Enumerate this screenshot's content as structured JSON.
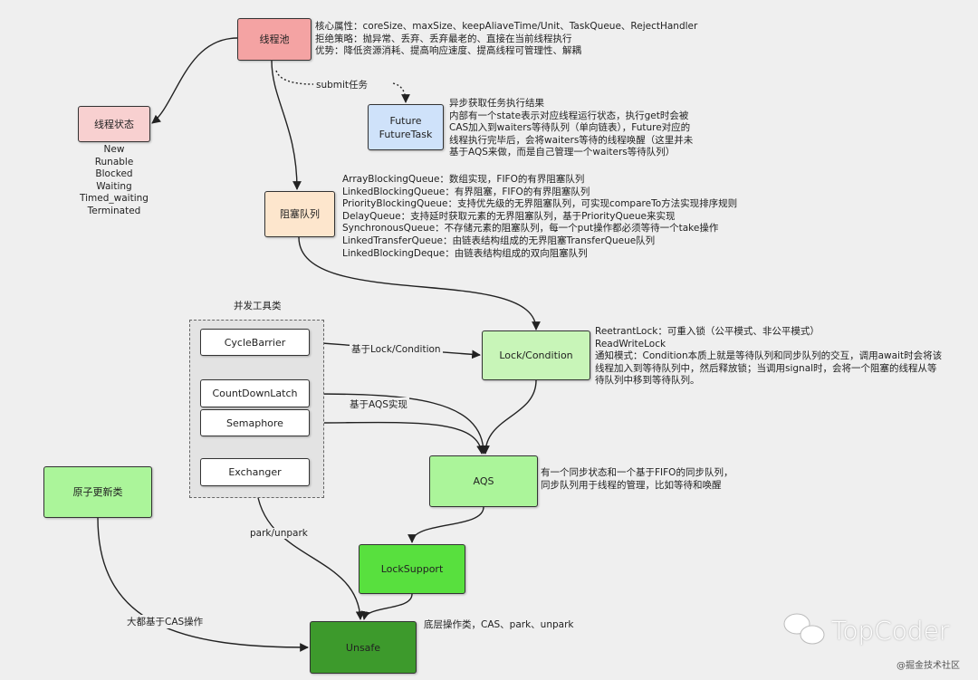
{
  "nodes": {
    "thread_pool": {
      "label": "线程池",
      "color": "#f4a3a3"
    },
    "thread_state": {
      "label": "线程状态",
      "color": "#f8d0d0"
    },
    "future": {
      "label": "Future\nFutureTask",
      "color": "#cfe2fa"
    },
    "blocking_queue": {
      "label": "阻塞队列",
      "color": "#fde6cd"
    },
    "lock_condition": {
      "label": "Lock/Condition",
      "color": "#c8f5b8"
    },
    "cycle_barrier": {
      "label": "CycleBarrier",
      "color": "#ffffff"
    },
    "count_down_latch": {
      "label": "CountDownLatch",
      "color": "#ffffff"
    },
    "semaphore": {
      "label": "Semaphore",
      "color": "#ffffff"
    },
    "exchanger": {
      "label": "Exchanger",
      "color": "#ffffff"
    },
    "aqs": {
      "label": "AQS",
      "color": "#abf59a"
    },
    "atomic": {
      "label": "原子更新类",
      "color": "#abf59a"
    },
    "lock_support": {
      "label": "LockSupport",
      "color": "#58e03e"
    },
    "unsafe": {
      "label": "Unsafe",
      "color": "#3d9a2c"
    }
  },
  "group": {
    "title": "并发工具类"
  },
  "notes": {
    "thread_pool": [
      "核心属性：coreSize、maxSize、keepAliaveTime/Unit、TaskQueue、RejectHandler",
      "拒绝策略：抛异常、丢弃、丢弃最老的、直接在当前线程执行",
      "优势：降低资源消耗、提高响应速度、提高线程可管理性、解耦"
    ],
    "thread_state": [
      "New",
      "Runable",
      "Blocked",
      "Waiting",
      "Timed_waiting",
      "Terminated"
    ],
    "future": [
      "异步获取任务执行结果",
      "内部有一个state表示对应线程运行状态，执行get时会被",
      "CAS加入到waiters等待队列（单向链表），Future对应的",
      "线程执行完毕后，会将waiters等待的线程唤醒（这里并未",
      "基于AQS来做，而是自己管理一个waiters等待队列）"
    ],
    "blocking_queue": [
      "ArrayBlockingQueue：数组实现，FIFO的有界阻塞队列",
      "LinkedBlockingQueue：有界阻塞，FIFO的有界阻塞队列",
      "PriorityBlockingQueue：支持优先级的无界阻塞队列，可实现compareTo方法实现排序规则",
      "DelayQueue：支持延时获取元素的无界阻塞队列，基于PriorityQueue来实现",
      "SynchronousQueue：不存储元素的阻塞队列，每一个put操作都必须等待一个take操作",
      "LinkedTransferQueue：由链表结构组成的无界阻塞TransferQueue队列",
      "LinkedBlockingDeque：由链表结构组成的双向阻塞队列"
    ],
    "lock_condition": [
      "ReetrantLock：可重入锁（公平模式、非公平模式）",
      "ReadWriteLock",
      "通知模式：Condition本质上就是等待队列和同步队列的交互，调用await时会将该",
      "线程加入到等待队列中，然后释放锁；当调用signal时，会将一个阻塞的线程从等",
      "待队列中移到等待队列。"
    ],
    "aqs": [
      "有一个同步状态和一个基于FIFO的同步队列，",
      "同步队列用于线程的管理，比如等待和唤醒"
    ],
    "unsafe": [
      "底层操作类，CAS、park、unpark"
    ]
  },
  "edge_labels": {
    "submit": "submit任务",
    "lock_condition": "基于Lock/Condition",
    "aqs": "基于AQS实现",
    "park": "park/unpark",
    "cas": "大都基于CAS操作"
  },
  "watermark": {
    "brand": "TopCoder",
    "sub": "@掘金技术社区"
  }
}
